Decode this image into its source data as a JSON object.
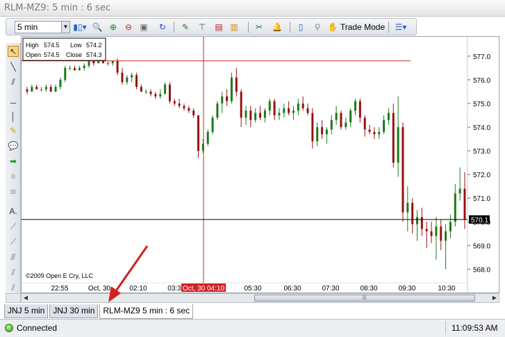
{
  "window": {
    "title": "RLM-MZ9: 5 min : 6 sec"
  },
  "toolbar": {
    "interval_value": "5 min",
    "trade_mode_label": "Trade Mode",
    "icons": [
      "bar-style-icon",
      "zoom-icon",
      "zoom-in-icon",
      "zoom-out-icon",
      "zoom-fit-icon",
      "refresh-icon",
      "drawing-icon",
      "tree-icon",
      "studies-icon",
      "columns-icon",
      "scissors-icon",
      "alert-bell-icon",
      "tablet-icon",
      "link-icon",
      "trade-hand-icon",
      "menu-icon"
    ]
  },
  "left_tools": [
    "pointer-icon",
    "line-icon",
    "parallel-lines-icon",
    "horizontal-line-icon",
    "vertical-line-icon",
    "text-note-icon",
    "callout-icon",
    "arrow-icon",
    "channel-icon",
    "fib-icon",
    "text-label-icon",
    "fan-icon",
    "gann-icon",
    "speed-lines-icon",
    "andrew-icon",
    "cycle-icon"
  ],
  "infobox": {
    "high_label": "High",
    "high": "574.5",
    "low_label": "Low",
    "low": "574.2",
    "open_label": "Open",
    "open": "574.5",
    "close_label": "Close",
    "close": "574.3"
  },
  "chart_data": {
    "type": "candlestick",
    "y_ticks": [
      "577.0",
      "576.0",
      "575.0",
      "574.0",
      "573.0",
      "572.0",
      "571.0",
      "570.0",
      "569.0",
      "568.0"
    ],
    "ylim": [
      567.6,
      577.7
    ],
    "x_ticks": [
      "22:55",
      "Oct, 30",
      "02:10",
      "03:3",
      "05:30",
      "06:30",
      "07:30",
      "08:30",
      "09:30",
      "10:30"
    ],
    "crosshair": {
      "time_label": "Oct, 30 04:10",
      "price": 576.8
    },
    "last_price": "570.1",
    "last_price_value": 570.1,
    "copyright": "©2009 Open E Cry, LLC",
    "colors": {
      "up": "#1a7a1a",
      "down": "#9a1010",
      "crosshair": "#d32020",
      "last": "#000000"
    },
    "candles": [
      {
        "o": 575.6,
        "h": 575.7,
        "l": 575.4,
        "c": 575.5
      },
      {
        "o": 575.5,
        "h": 575.8,
        "l": 575.5,
        "c": 575.7
      },
      {
        "o": 575.7,
        "h": 575.8,
        "l": 575.6,
        "c": 575.6
      },
      {
        "o": 575.6,
        "h": 575.7,
        "l": 575.5,
        "c": 575.6
      },
      {
        "o": 575.6,
        "h": 575.8,
        "l": 575.5,
        "c": 575.7
      },
      {
        "o": 575.7,
        "h": 575.8,
        "l": 575.5,
        "c": 575.5
      },
      {
        "o": 575.5,
        "h": 575.8,
        "l": 575.5,
        "c": 575.7
      },
      {
        "o": 575.7,
        "h": 576.1,
        "l": 575.6,
        "c": 576.0
      },
      {
        "o": 576.0,
        "h": 576.6,
        "l": 575.9,
        "c": 576.5
      },
      {
        "o": 576.5,
        "h": 576.6,
        "l": 576.4,
        "c": 576.5
      },
      {
        "o": 576.5,
        "h": 576.6,
        "l": 576.4,
        "c": 576.4
      },
      {
        "o": 576.4,
        "h": 576.6,
        "l": 576.4,
        "c": 576.5
      },
      {
        "o": 576.5,
        "h": 576.7,
        "l": 576.4,
        "c": 576.6
      },
      {
        "o": 576.6,
        "h": 577.0,
        "l": 576.5,
        "c": 576.9
      },
      {
        "o": 576.9,
        "h": 576.9,
        "l": 576.6,
        "c": 576.7
      },
      {
        "o": 576.7,
        "h": 576.8,
        "l": 576.7,
        "c": 576.8
      },
      {
        "o": 576.8,
        "h": 576.8,
        "l": 576.7,
        "c": 576.7
      },
      {
        "o": 576.7,
        "h": 576.8,
        "l": 576.6,
        "c": 576.7
      },
      {
        "o": 576.7,
        "h": 576.8,
        "l": 576.6,
        "c": 576.8
      },
      {
        "o": 576.8,
        "h": 576.9,
        "l": 576.2,
        "c": 576.3
      },
      {
        "o": 576.3,
        "h": 576.5,
        "l": 575.8,
        "c": 575.9
      },
      {
        "o": 575.9,
        "h": 576.2,
        "l": 575.8,
        "c": 576.1
      },
      {
        "o": 576.1,
        "h": 576.3,
        "l": 575.9,
        "c": 576.2
      },
      {
        "o": 576.2,
        "h": 576.3,
        "l": 575.6,
        "c": 575.7
      },
      {
        "o": 575.7,
        "h": 575.8,
        "l": 575.5,
        "c": 575.5
      },
      {
        "o": 575.5,
        "h": 575.6,
        "l": 575.4,
        "c": 575.5
      },
      {
        "o": 575.5,
        "h": 575.6,
        "l": 575.3,
        "c": 575.4
      },
      {
        "o": 575.4,
        "h": 575.5,
        "l": 575.2,
        "c": 575.3
      },
      {
        "o": 575.3,
        "h": 575.6,
        "l": 575.2,
        "c": 575.4
      },
      {
        "o": 575.4,
        "h": 575.9,
        "l": 575.4,
        "c": 575.8
      },
      {
        "o": 575.8,
        "h": 575.9,
        "l": 575.0,
        "c": 575.1
      },
      {
        "o": 575.1,
        "h": 575.2,
        "l": 574.9,
        "c": 575.0
      },
      {
        "o": 575.0,
        "h": 575.2,
        "l": 574.8,
        "c": 574.9
      },
      {
        "o": 574.9,
        "h": 575.0,
        "l": 574.7,
        "c": 574.8
      },
      {
        "o": 574.8,
        "h": 574.9,
        "l": 574.6,
        "c": 574.7
      },
      {
        "o": 574.7,
        "h": 574.8,
        "l": 574.4,
        "c": 574.5
      },
      {
        "o": 574.5,
        "h": 574.5,
        "l": 572.7,
        "c": 573.0
      },
      {
        "o": 573.0,
        "h": 573.5,
        "l": 572.9,
        "c": 573.3
      },
      {
        "o": 573.3,
        "h": 573.9,
        "l": 573.2,
        "c": 573.8
      },
      {
        "o": 573.8,
        "h": 574.5,
        "l": 573.7,
        "c": 574.4
      },
      {
        "o": 574.4,
        "h": 575.1,
        "l": 574.3,
        "c": 575.0
      },
      {
        "o": 575.0,
        "h": 575.5,
        "l": 574.6,
        "c": 575.3
      },
      {
        "o": 575.3,
        "h": 575.6,
        "l": 574.9,
        "c": 575.1
      },
      {
        "o": 575.1,
        "h": 576.3,
        "l": 575.0,
        "c": 576.1
      },
      {
        "o": 576.1,
        "h": 576.5,
        "l": 575.3,
        "c": 575.5
      },
      {
        "o": 575.5,
        "h": 575.6,
        "l": 574.0,
        "c": 574.4
      },
      {
        "o": 574.4,
        "h": 574.9,
        "l": 574.1,
        "c": 574.7
      },
      {
        "o": 574.7,
        "h": 574.9,
        "l": 574.0,
        "c": 574.3
      },
      {
        "o": 574.3,
        "h": 574.8,
        "l": 574.2,
        "c": 574.6
      },
      {
        "o": 574.6,
        "h": 574.9,
        "l": 574.3,
        "c": 574.4
      },
      {
        "o": 574.4,
        "h": 574.8,
        "l": 574.2,
        "c": 574.7
      },
      {
        "o": 574.7,
        "h": 575.2,
        "l": 574.5,
        "c": 575.1
      },
      {
        "o": 575.1,
        "h": 575.2,
        "l": 574.3,
        "c": 574.5
      },
      {
        "o": 574.5,
        "h": 574.8,
        "l": 574.3,
        "c": 574.6
      },
      {
        "o": 574.6,
        "h": 575.0,
        "l": 574.4,
        "c": 574.8
      },
      {
        "o": 574.8,
        "h": 575.1,
        "l": 574.5,
        "c": 574.6
      },
      {
        "o": 574.6,
        "h": 574.9,
        "l": 574.3,
        "c": 574.7
      },
      {
        "o": 574.7,
        "h": 575.2,
        "l": 574.5,
        "c": 575.0
      },
      {
        "o": 575.0,
        "h": 575.3,
        "l": 574.7,
        "c": 574.8
      },
      {
        "o": 574.8,
        "h": 575.0,
        "l": 574.5,
        "c": 574.6
      },
      {
        "o": 574.6,
        "h": 574.8,
        "l": 573.1,
        "c": 573.4
      },
      {
        "o": 573.4,
        "h": 574.2,
        "l": 573.2,
        "c": 574.0
      },
      {
        "o": 574.0,
        "h": 574.3,
        "l": 573.5,
        "c": 573.7
      },
      {
        "o": 573.7,
        "h": 574.0,
        "l": 573.3,
        "c": 573.9
      },
      {
        "o": 573.9,
        "h": 574.5,
        "l": 573.7,
        "c": 574.3
      },
      {
        "o": 574.3,
        "h": 574.9,
        "l": 574.1,
        "c": 574.6
      },
      {
        "o": 574.6,
        "h": 574.7,
        "l": 573.9,
        "c": 574.0
      },
      {
        "o": 574.0,
        "h": 574.4,
        "l": 573.9,
        "c": 574.2
      },
      {
        "o": 574.2,
        "h": 574.8,
        "l": 574.0,
        "c": 574.7
      },
      {
        "o": 574.7,
        "h": 575.2,
        "l": 574.5,
        "c": 575.1
      },
      {
        "o": 575.1,
        "h": 575.2,
        "l": 574.2,
        "c": 574.4
      },
      {
        "o": 574.4,
        "h": 574.5,
        "l": 573.6,
        "c": 573.9
      },
      {
        "o": 573.9,
        "h": 574.1,
        "l": 573.7,
        "c": 573.8
      },
      {
        "o": 573.8,
        "h": 574.0,
        "l": 573.5,
        "c": 573.7
      },
      {
        "o": 573.7,
        "h": 574.0,
        "l": 573.5,
        "c": 573.8
      },
      {
        "o": 573.8,
        "h": 574.5,
        "l": 573.7,
        "c": 574.3
      },
      {
        "o": 574.3,
        "h": 574.8,
        "l": 574.1,
        "c": 574.6
      },
      {
        "o": 574.6,
        "h": 575.0,
        "l": 572.3,
        "c": 572.5
      },
      {
        "o": 572.5,
        "h": 575.3,
        "l": 571.9,
        "c": 574.0
      },
      {
        "o": 574.0,
        "h": 574.2,
        "l": 570.0,
        "c": 570.4
      },
      {
        "o": 570.4,
        "h": 571.5,
        "l": 569.6,
        "c": 570.8
      },
      {
        "o": 570.8,
        "h": 571.0,
        "l": 569.5,
        "c": 569.9
      },
      {
        "o": 569.9,
        "h": 570.5,
        "l": 569.2,
        "c": 570.2
      },
      {
        "o": 570.2,
        "h": 570.6,
        "l": 569.4,
        "c": 569.7
      },
      {
        "o": 569.7,
        "h": 570.0,
        "l": 568.9,
        "c": 569.6
      },
      {
        "o": 569.6,
        "h": 570.0,
        "l": 569.1,
        "c": 569.4
      },
      {
        "o": 569.4,
        "h": 570.2,
        "l": 568.4,
        "c": 569.8
      },
      {
        "o": 569.8,
        "h": 570.1,
        "l": 568.8,
        "c": 569.2
      },
      {
        "o": 569.2,
        "h": 569.9,
        "l": 568.0,
        "c": 569.6
      },
      {
        "o": 569.6,
        "h": 570.3,
        "l": 569.3,
        "c": 570.0
      },
      {
        "o": 570.0,
        "h": 571.6,
        "l": 569.8,
        "c": 571.2
      },
      {
        "o": 571.2,
        "h": 572.3,
        "l": 570.9,
        "c": 571.4
      },
      {
        "o": 571.4,
        "h": 572.1,
        "l": 569.7,
        "c": 570.1
      }
    ]
  },
  "tabs": [
    {
      "label": "JNJ 5 min"
    },
    {
      "label": "JNJ 30 min"
    },
    {
      "label": "RLM-MZ9 5 min : 6 sec"
    }
  ],
  "status": {
    "connection": "Connected",
    "clock": "11:09:53 AM"
  }
}
